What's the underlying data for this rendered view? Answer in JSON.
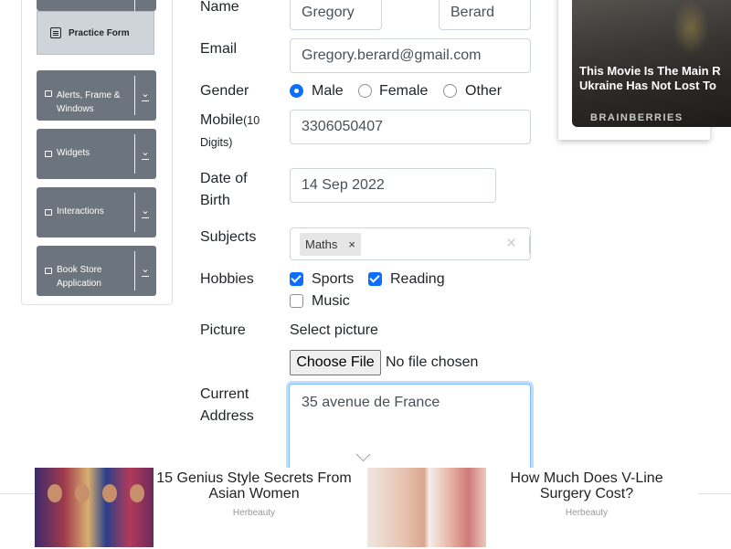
{
  "sidebar": {
    "practice_form_label": "Practice Form",
    "groups": [
      {
        "label": "Alerts, Frame & Windows"
      },
      {
        "label": "Widgets"
      },
      {
        "label": "Interactions"
      },
      {
        "label": "Book Store Application"
      }
    ]
  },
  "form": {
    "name_label": "Name",
    "first_name": "Gregory",
    "last_name": "Berard",
    "email_label": "Email",
    "email": "Gregory.berard@gmail.com",
    "gender_label": "Gender",
    "gender_options": [
      "Male",
      "Female",
      "Other"
    ],
    "gender_selected": "Male",
    "mobile_label": "Mobile",
    "mobile_hint": "(10 Digits)",
    "mobile": "3306050407",
    "dob_label": "Date of Birth",
    "dob": "14 Sep 2022",
    "subjects_label": "Subjects",
    "subjects": [
      "Maths"
    ],
    "hobbies_label": "Hobbies",
    "hobbies": [
      {
        "label": "Sports",
        "checked": true
      },
      {
        "label": "Reading",
        "checked": true
      },
      {
        "label": "Music",
        "checked": false
      }
    ],
    "picture_label": "Picture",
    "select_picture": "Select picture",
    "choose_file": "Choose File",
    "no_file": "No file chosen",
    "address_label": "Current Address",
    "address": "35 avenue de France"
  },
  "ads": {
    "side": {
      "headline_1": "This Movie Is The Main R",
      "headline_2": "Ukraine Has Not Lost To",
      "brand": "BRAINBERRIES"
    },
    "bottom": [
      {
        "title": "15 Genius Style Secrets From Asian Women",
        "source": "Herbeauty"
      },
      {
        "title": "How Much Does V-Line Surgery Cost?",
        "source": "Herbeauty"
      }
    ]
  },
  "colors": {
    "accent": "#0d6efd",
    "sidebar_group": "#6c757d",
    "sidebar_active": "#ced4da"
  }
}
